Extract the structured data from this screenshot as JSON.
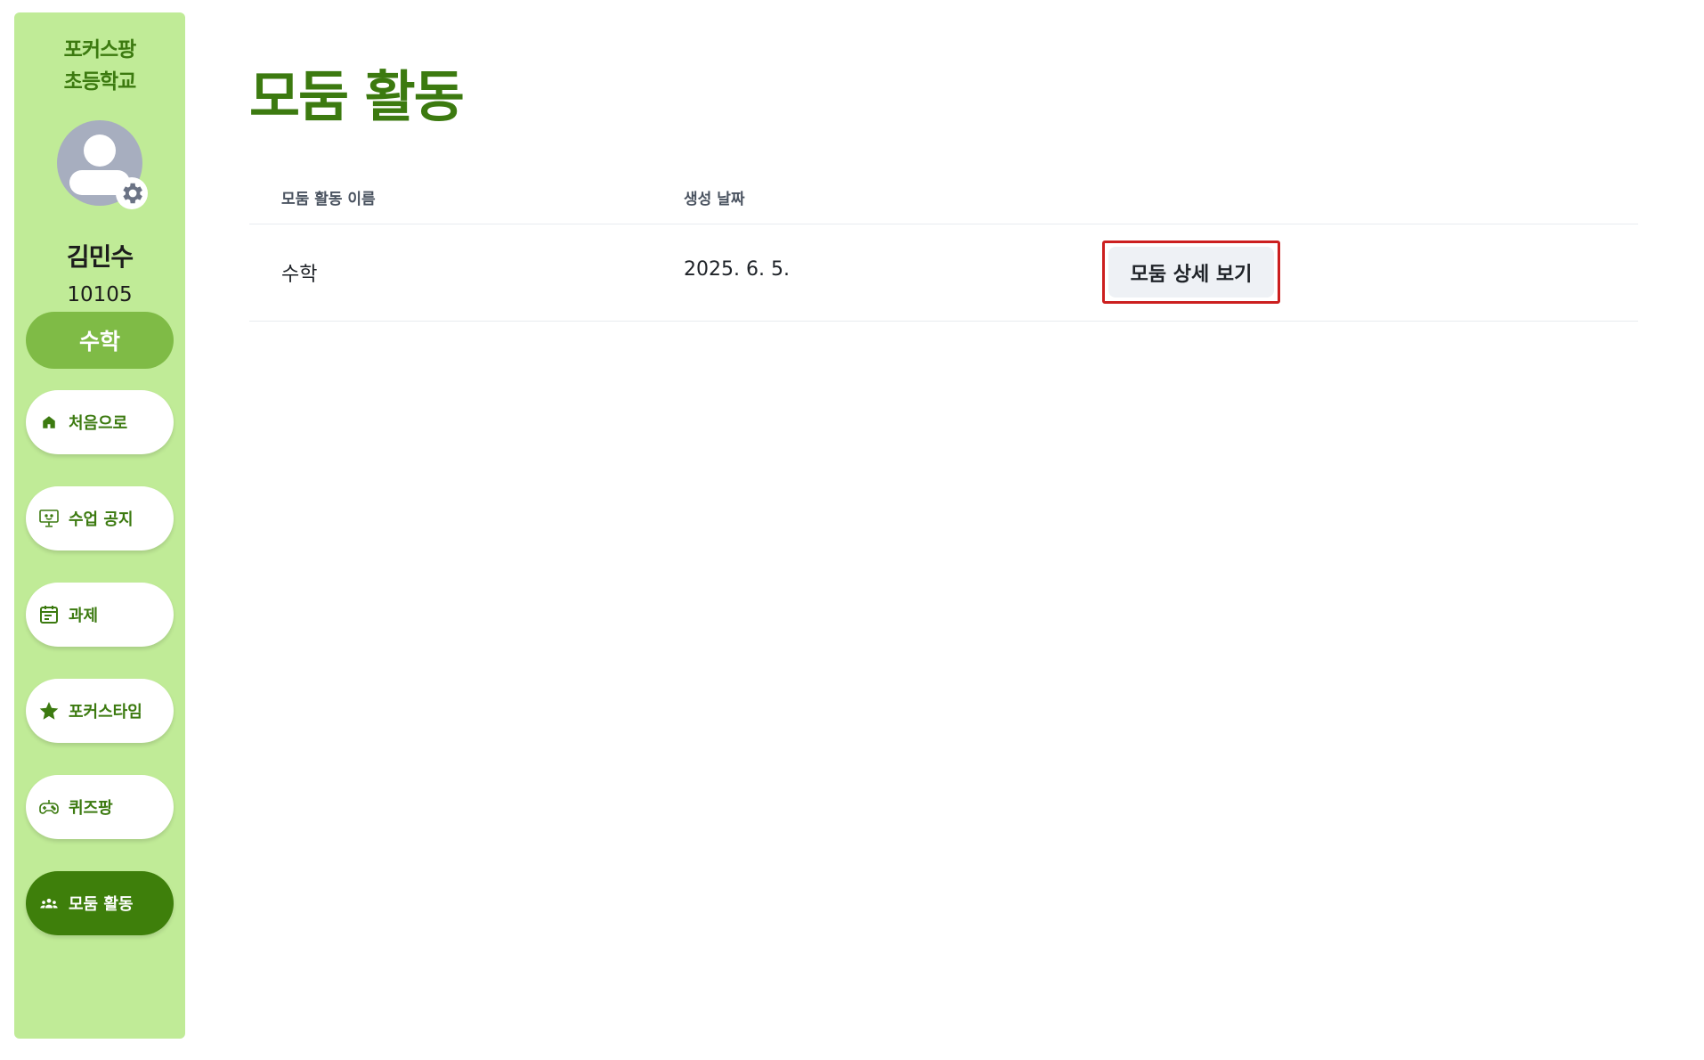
{
  "sidebar": {
    "school_line1": "포커스팡",
    "school_line2": "초등학교",
    "user_name": "김민수",
    "user_id": "10105",
    "subject": "수학",
    "items": [
      {
        "label": "처음으로",
        "icon": "home-icon"
      },
      {
        "label": "수업 공지",
        "icon": "presentation-icon"
      },
      {
        "label": "과제",
        "icon": "calendar-icon"
      },
      {
        "label": "포커스타임",
        "icon": "star-icon"
      },
      {
        "label": "퀴즈팡",
        "icon": "gamepad-icon"
      },
      {
        "label": "모둠 활동",
        "icon": "group-icon",
        "active": true
      }
    ]
  },
  "main": {
    "title": "모둠 활동",
    "columns": [
      "모둠 활동 이름",
      "생성 날짜"
    ],
    "rows": [
      {
        "name": "수학",
        "date": "2025. 6. 5.",
        "action": "모둠 상세 보기"
      }
    ]
  },
  "colors": {
    "sidebar_bg": "#c0eb97",
    "brand_green": "#3c7a10",
    "subject_badge": "#7fbb46",
    "active_nav": "#3e7f0b",
    "highlight_border": "#cc1f1f"
  }
}
